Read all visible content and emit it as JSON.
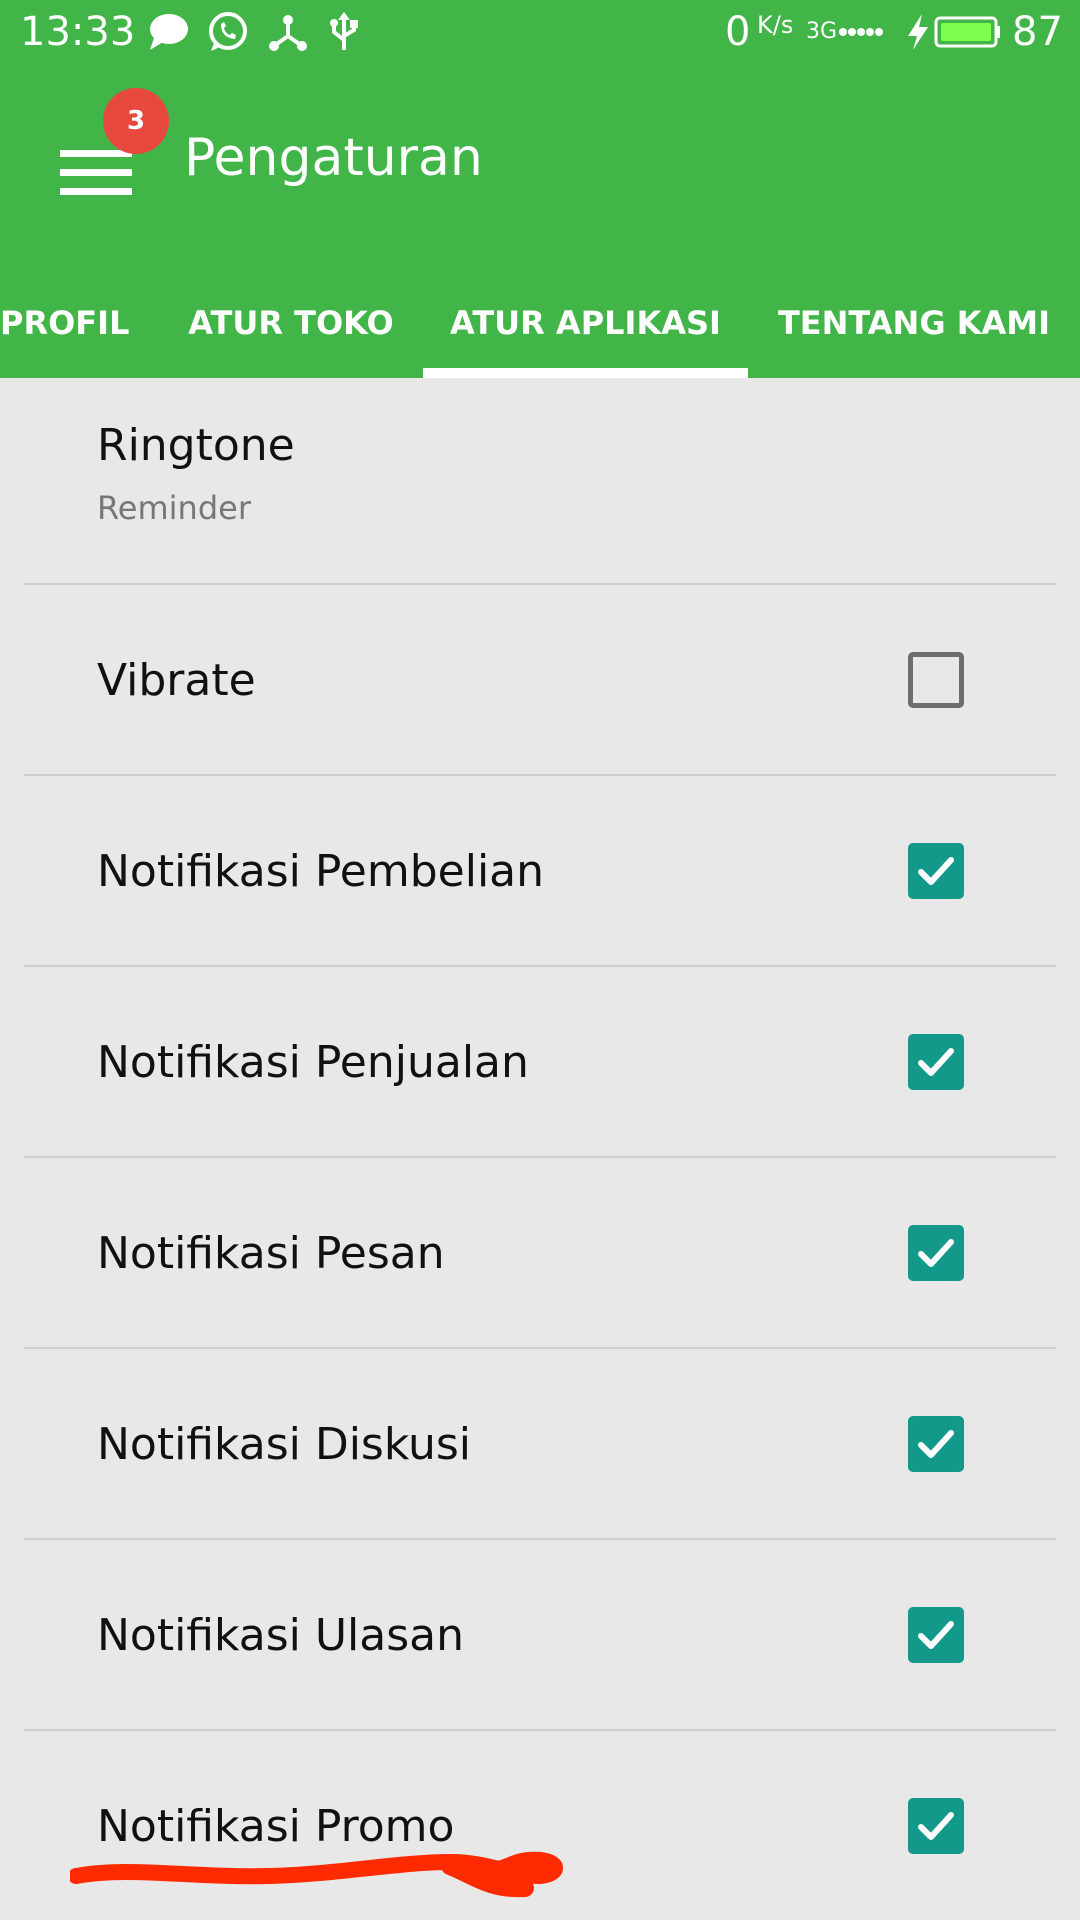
{
  "status_bar": {
    "time": "13:33",
    "net_speed": "0",
    "net_unit": "K/s",
    "net_type": "3G",
    "battery": "87",
    "icons": [
      "chat-bubble-icon",
      "whatsapp-icon",
      "share-icon",
      "usb-icon",
      "signal-dots-icon",
      "charging-bolt-icon",
      "battery-icon"
    ]
  },
  "app_bar": {
    "menu_badge": "3",
    "title": "Pengaturan"
  },
  "tabs": [
    {
      "label": "PROFIL",
      "active": false
    },
    {
      "label": "ATUR TOKO",
      "active": false
    },
    {
      "label": "ATUR APLIKASI",
      "active": true
    },
    {
      "label": "TENTANG KAMI",
      "active": false
    }
  ],
  "settings": [
    {
      "title": "Ringtone",
      "summary": "Reminder"
    },
    {
      "title": "Vibrate",
      "checked": false
    },
    {
      "title": "Notifikasi Pembelian",
      "checked": true
    },
    {
      "title": "Notifikasi Penjualan",
      "checked": true
    },
    {
      "title": "Notifikasi Pesan",
      "checked": true
    },
    {
      "title": "Notifikasi Diskusi",
      "checked": true
    },
    {
      "title": "Notifikasi Ulasan",
      "checked": true
    },
    {
      "title": "Notifikasi Promo",
      "checked": true
    }
  ],
  "colors": {
    "primary": "#42b549",
    "checkbox_on": "#12998a",
    "badge": "#e8493f",
    "annotation": "#ff2a00",
    "background": "#e8e8e8"
  }
}
